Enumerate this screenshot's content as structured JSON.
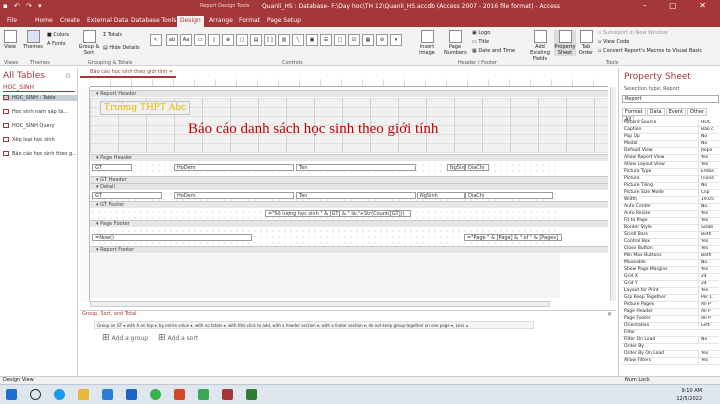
{
  "titlebar": {
    "tools_label": "Report Design Tools",
    "title": "Quanli_HS : Database- F:\\Day hoc\\TH 12\\Quanli_HS.accdb (Access 2007 - 2016 file format) - Access"
  },
  "tabs": [
    "File",
    "Home",
    "Create",
    "External Data",
    "Database Tools",
    "Design",
    "Arrange",
    "Format",
    "Page Setup"
  ],
  "active_tab": "Design",
  "ribbon": {
    "view": "View",
    "themes": "Themes",
    "colors": "Colors",
    "fonts": "Fonts",
    "group_sort": "Group & Sort",
    "totals": "Totals",
    "hide_details": "Hide Details",
    "insert_image": "Insert Image",
    "page_numbers": "Page Numbers",
    "logo": "Logo",
    "title": "Title",
    "date_time": "Date and Time",
    "add_existing_fields": "Add Existing Fields",
    "property_sheet": "Property Sheet",
    "tab_order": "Tab Order",
    "subreport": "Subreport in New Window",
    "view_code": "View Code",
    "convert_macros": "Convert Report's Macros to Visual Basic",
    "groups": {
      "views": "Views",
      "themes": "Themes",
      "grouping": "Grouping & Totals",
      "controls": "Controls",
      "header_footer": "Header / Footer",
      "tools": "Tools"
    }
  },
  "nav": {
    "header": "All Tables",
    "group": "HOC_SINH",
    "items": [
      {
        "label": "HOC_SINH : Table",
        "selected": true
      },
      {
        "label": "Học sinh nam sắp tă...",
        "selected": false
      },
      {
        "label": "HOC_SINH Query",
        "selected": false
      },
      {
        "label": "Xếp loại học sinh",
        "selected": false
      },
      {
        "label": "Báo cáo học sinh theo g...",
        "selected": false
      }
    ]
  },
  "document": {
    "tab_label": "Báo cáo học sinh theo giới tính",
    "sections": {
      "report_header": "Report Header",
      "page_header": "Page Header",
      "gt_header": "GT Header",
      "detail": "Detail",
      "gt_footer": "GT Footer",
      "page_footer": "Page Footer",
      "report_footer": "Report Footer"
    },
    "school_label": "Trường THPT Abc",
    "report_title": "Báo cáo danh sách học sinh theo giới tính",
    "page_header_fields": [
      "GT",
      "HoDem",
      "Ten",
      "NgSinh",
      "DiaChi"
    ],
    "detail_fields": [
      "GT",
      "HoDem",
      "Ten",
      "NgSinh",
      "DiaChi"
    ],
    "gt_footer_expr": "=\"Số lượng học sinh \" & [GT] & \" là:\"+Str(Count([GT]))",
    "page_footer_now": "=Now()",
    "page_footer_page": "=\"Page \" & [Page] & \" of \" & [Pages]"
  },
  "group_pane": {
    "title": "Group, Sort, and Total",
    "row": "Group on GT ▾ with A on top ▾, by entire value ▾, with no totals ▾, with title click to add, with a header section ▾, with a footer section ▾, do not keep group together on one page ▾, Less ◂",
    "add_group": "Add a group",
    "add_sort": "Add a sort"
  },
  "properties": {
    "title": "Property Sheet",
    "selection_type": "Selection type: Report",
    "selected": "Report",
    "tabs": [
      "Format",
      "Data",
      "Event",
      "Other",
      "All"
    ],
    "active_tab": "All",
    "rows": [
      [
        "Record Source",
        "HOC"
      ],
      [
        "Caption",
        "Báo c"
      ],
      [
        "Pop Up",
        "No"
      ],
      [
        "Modal",
        "No"
      ],
      [
        "Default View",
        "Repo"
      ],
      [
        "Allow Report View",
        "Yes"
      ],
      [
        "Allow Layout View",
        "Yes"
      ],
      [
        "Picture Type",
        "Embe"
      ],
      [
        "Picture",
        "(none"
      ],
      [
        "Picture Tiling",
        "No"
      ],
      [
        "Picture Size Mode",
        "Clip"
      ],
      [
        "Width",
        "19.05"
      ],
      [
        "Auto Center",
        "No"
      ],
      [
        "Auto Resize",
        "Yes"
      ],
      [
        "Fit to Page",
        "Yes"
      ],
      [
        "Border Style",
        "Sizab"
      ],
      [
        "Scroll Bars",
        "Both"
      ],
      [
        "Control Box",
        "Yes"
      ],
      [
        "Close Button",
        "Yes"
      ],
      [
        "Min Max Buttons",
        "Both"
      ],
      [
        "Moveable",
        "No"
      ],
      [
        "Show Page Margins",
        "Yes"
      ],
      [
        "Grid X",
        "24"
      ],
      [
        "Grid Y",
        "24"
      ],
      [
        "Layout for Print",
        "Yes"
      ],
      [
        "Grp Keep Together",
        "Per C"
      ],
      [
        "Picture Pages",
        "All P"
      ],
      [
        "Page Header",
        "All P"
      ],
      [
        "Page Footer",
        "All P"
      ],
      [
        "Orientation",
        "Left-"
      ],
      [
        "Filter",
        ""
      ],
      [
        "Filter On Load",
        "No"
      ],
      [
        "Order By",
        ""
      ],
      [
        "Order By On Load",
        "Yes"
      ],
      [
        "Allow Filters",
        "Yes"
      ]
    ]
  },
  "status": {
    "left": "Design View",
    "right": "Num Lock"
  },
  "taskbar": {
    "time": "9:10 AM",
    "date": "12/5/2022"
  },
  "colors": {
    "accent": "#a4373a",
    "title_red": "#c00000",
    "school_yellow": "#e6b800"
  }
}
